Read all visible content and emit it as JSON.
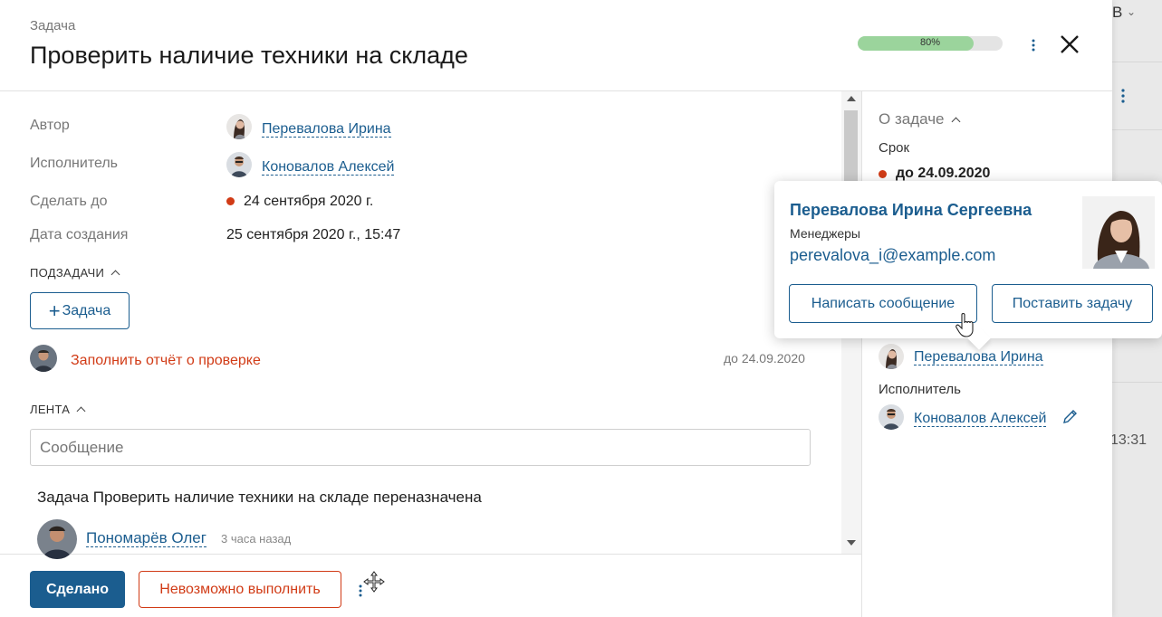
{
  "background": {
    "letter": "В",
    "time": "13:31"
  },
  "header": {
    "type_label": "Задача",
    "title": "Проверить наличие техники на складе",
    "progress_value": 0.8,
    "progress_label": "80%"
  },
  "details": {
    "author_label": "Автор",
    "author_name": "Перевалова Ирина",
    "executor_label": "Исполнитель",
    "executor_name": "Коновалов Алексей",
    "due_label": "Сделать до",
    "due_value": "24 сентября 2020 г.",
    "created_label": "Дата создания",
    "created_value": "25 сентября 2020 г., 15:47"
  },
  "subtasks": {
    "section_label": "ПОДЗАДАЧИ",
    "add_button_label": "Задача",
    "items": [
      {
        "title": "Заполнить отчёт о проверке",
        "due": "до 24.09.2020"
      }
    ]
  },
  "feed": {
    "section_label": "ЛЕНТА",
    "input_placeholder": "Сообщение",
    "entries": [
      {
        "title": "Задача Проверить наличие техники на складе переназначена",
        "author": "Пономарёв Олег",
        "time": "3 часа назад"
      }
    ]
  },
  "footer": {
    "done_label": "Сделано",
    "fail_label": "Невозможно выполнить"
  },
  "right_panel": {
    "section_label": "О задаче",
    "deadline_label": "Срок",
    "deadline_value": "до 24.09.2020",
    "author_name": "Перевалова Ирина",
    "executor_label": "Исполнитель",
    "executor_name": "Коновалов Алексей"
  },
  "popup": {
    "full_name": "Перевалова Ирина Сергеевна",
    "department": "Менеджеры",
    "email": "perevalova_i@example.com",
    "message_button": "Написать сообщение",
    "task_button": "Поставить задачу"
  },
  "colors": {
    "accent": "#1b5d8f",
    "danger": "#d13b16",
    "progress_fill": "#9bd49c"
  }
}
